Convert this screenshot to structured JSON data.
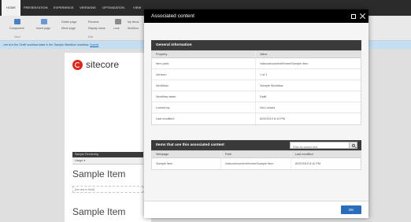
{
  "editor": {
    "tabs": [
      {
        "label": "HOME",
        "active": true
      },
      {
        "label": "PRESENTATION",
        "active": false
      },
      {
        "label": "EXPERIENCE",
        "active": false
      },
      {
        "label": "VERSIONS",
        "active": false
      },
      {
        "label": "OPTIMIZATION",
        "active": false
      },
      {
        "label": "VIEW",
        "active": false
      }
    ],
    "ribbon": {
      "component": "Component",
      "view": "View",
      "insert_page": "Insert page",
      "delete_page": "Delete page",
      "move_page": "Move page",
      "rename": "Rename",
      "display_name": "Display name",
      "edit": "Edit",
      "lock": "Lock",
      "my_items": "My items",
      "workbox": "Workbox"
    },
    "notice": {
      "text": "...em is in the 'Draft' workflow state in the 'Sample Workflow' workflow.",
      "link": "Submit"
    },
    "logo_text": "sitecore",
    "rendering_label": "Sample Rendering",
    "rendering_tools": "Usage ▾",
    "page_title_1": "Sample Item",
    "placeholder_text": "[No text in field]",
    "page_title_2": "Sample Item"
  },
  "dialog": {
    "title": "Associated content",
    "general": {
      "heading": "General information",
      "col_property": "Property",
      "col_value": "Value",
      "rows": [
        {
          "property": "Item path:",
          "value": "/sitecore/content/Home/Sample Item"
        },
        {
          "property": "Version:",
          "value": "1 of 1"
        },
        {
          "property": "Workflow:",
          "value": "Sample Workflow"
        },
        {
          "property": "Workflow state:",
          "value": "Draft"
        },
        {
          "property": "Locked by:",
          "value": "Not Locked"
        },
        {
          "property": "Last modified:",
          "value": "8/29/2019 8:10 PM"
        }
      ]
    },
    "items": {
      "heading": "Items that use this associated content",
      "search_placeholder": "Filter by search text",
      "col_webpage": "Webpage",
      "col_path": "Path",
      "col_modified": "Last modified",
      "rows": [
        {
          "webpage": "Sample Item",
          "path": "/sitecore/content/Home/Sample Item",
          "modified": "8/29/2019 8:10 PM"
        }
      ]
    },
    "ok_label": "OK"
  },
  "colors": {
    "dialog_header": "#000000",
    "section_header": "#3a3a3a",
    "ok_button": "#2a6ebb",
    "logo_red": "#dc291e"
  }
}
